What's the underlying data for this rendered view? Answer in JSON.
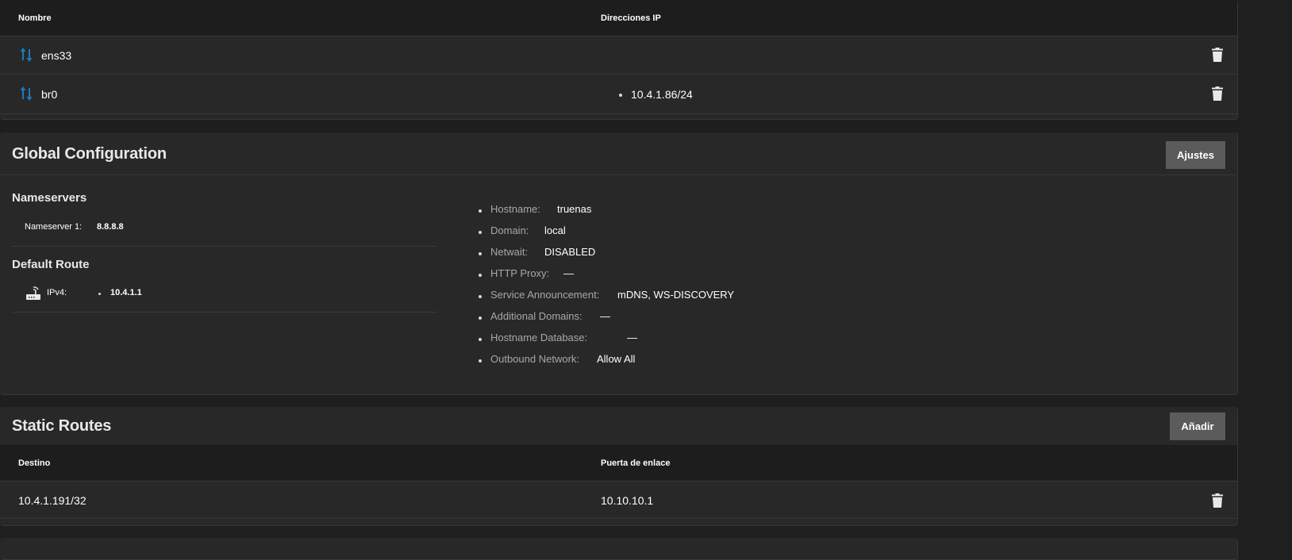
{
  "interfaces": {
    "columns": {
      "name": "Nombre",
      "ip": "Direcciones IP"
    },
    "rows": [
      {
        "name": "ens33",
        "ip": ""
      },
      {
        "name": "br0",
        "ip": "10.4.1.86/24"
      }
    ],
    "icon": "interface-updown-icon",
    "delete_icon": "trash-icon"
  },
  "global_config": {
    "title": "Global Configuration",
    "settings_button": "Ajustes",
    "nameservers": {
      "title": "Nameservers",
      "items": [
        {
          "label": "Nameserver 1:",
          "value": "8.8.8.8"
        }
      ]
    },
    "default_route": {
      "title": "Default Route",
      "icon": "router-icon",
      "label": "IPv4:",
      "value": "10.4.1.1"
    },
    "details": [
      {
        "label": "Hostname:",
        "value": "truenas"
      },
      {
        "label": "Domain:",
        "value": "local"
      },
      {
        "label": "Netwait:",
        "value": "DISABLED"
      },
      {
        "label": "HTTP Proxy:",
        "value": "—"
      },
      {
        "label": "Service Announcement:",
        "value": "mDNS, WS-DISCOVERY"
      },
      {
        "label": "Additional Domains:",
        "value": "—"
      },
      {
        "label": "Hostname Database:",
        "value": "—"
      },
      {
        "label": "Outbound Network:",
        "value": "Allow All"
      }
    ]
  },
  "static_routes": {
    "title": "Static Routes",
    "add_button": "Añadir",
    "columns": {
      "destination": "Destino",
      "gateway": "Puerta de enlace"
    },
    "rows": [
      {
        "destination": "10.4.1.191/32",
        "gateway": "10.10.10.1"
      }
    ]
  },
  "colors": {
    "background": "#1f1f1f",
    "card": "#282828",
    "header": "#1d1d1d",
    "button": "#5b5b5b",
    "interface_icon": "#1f7ab8"
  }
}
